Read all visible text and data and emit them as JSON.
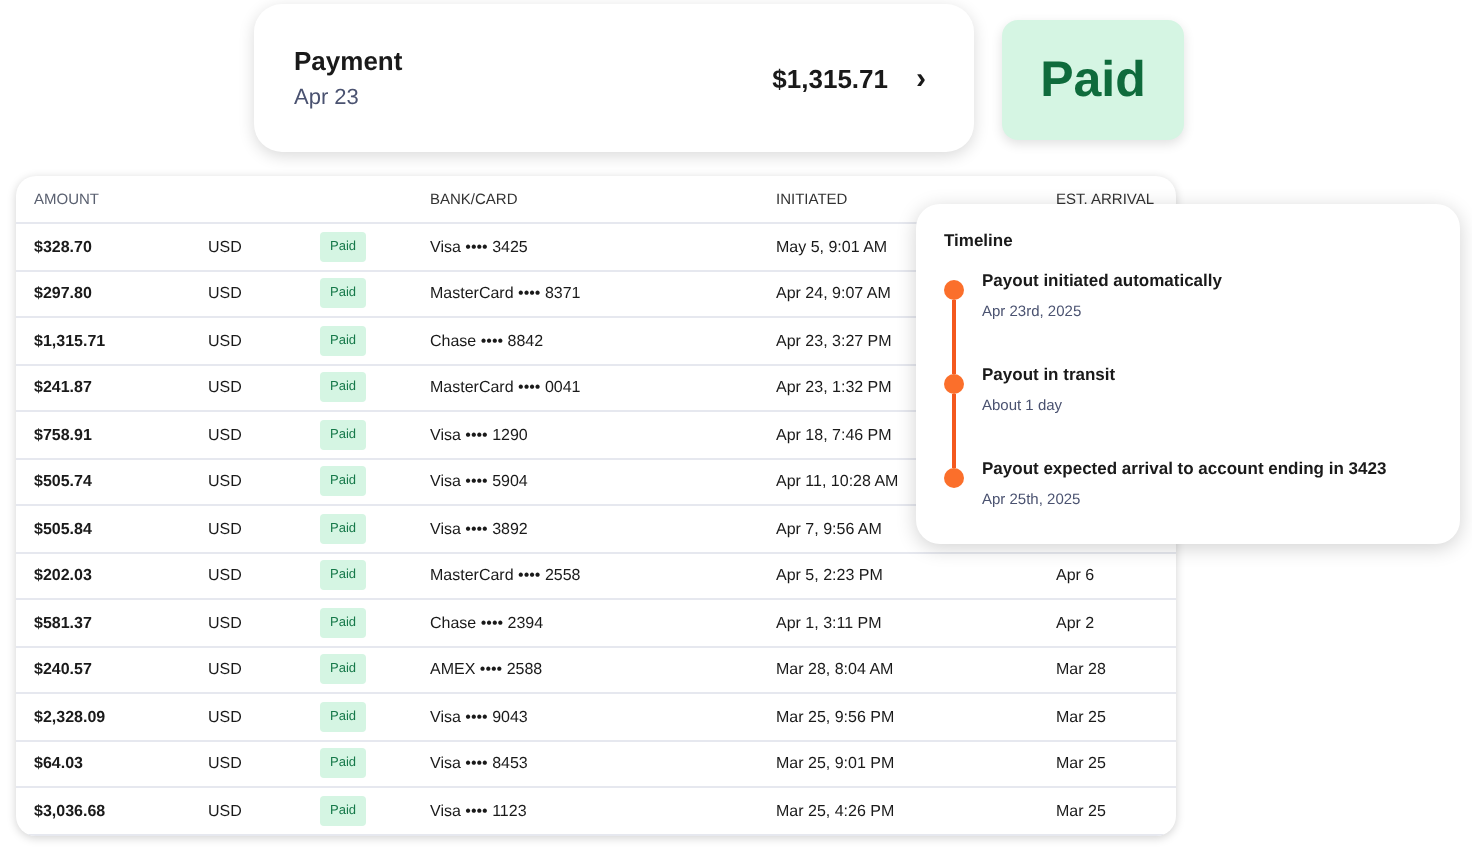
{
  "payment_card": {
    "title": "Payment",
    "date": "Apr 23",
    "amount": "$1,315.71",
    "chevron": "›"
  },
  "status_badge": "Paid",
  "table": {
    "columns": [
      "AMOUNT",
      "",
      "BANK/CARD",
      "INITIATED",
      "EST. ARRIVAL"
    ],
    "rows": [
      {
        "amount": "$328.70",
        "currency": "USD",
        "status": "Paid",
        "card": "Visa •••• 3425",
        "initiated": "May 5, 9:01 AM"
      },
      {
        "amount": "$297.80",
        "currency": "USD",
        "status": "Paid",
        "card": "MasterCard •••• 8371",
        "initiated": "Apr 24, 9:07 AM"
      },
      {
        "amount": "$1,315.71",
        "currency": "USD",
        "status": "Paid",
        "card": "Chase •••• 8842",
        "initiated": "Apr 23, 3:27 PM"
      },
      {
        "amount": "$241.87",
        "currency": "USD",
        "status": "Paid",
        "card": "MasterCard •••• 0041",
        "initiated": "Apr 23, 1:32 PM"
      },
      {
        "amount": "$758.91",
        "currency": "USD",
        "status": "Paid",
        "card": "Visa •••• 1290",
        "initiated": "Apr 18, 7:46 PM"
      },
      {
        "amount": "$505.74",
        "currency": "USD",
        "status": "Paid",
        "card": "Visa •••• 5904",
        "initiated": "Apr 11, 10:28 AM"
      },
      {
        "amount": "$505.84",
        "currency": "USD",
        "status": "Paid",
        "card": "Visa •••• 3892",
        "initiated": "Apr 7, 9:56 AM"
      },
      {
        "amount": "$202.03",
        "currency": "USD",
        "status": "Paid",
        "card": "MasterCard •••• 2558",
        "initiated": "Apr 5, 2:23 PM",
        "est_arrival": "Apr 6"
      },
      {
        "amount": "$581.37",
        "currency": "USD",
        "status": "Paid",
        "card": "Chase •••• 2394",
        "initiated": "Apr 1, 3:11 PM",
        "est_arrival": "Apr 2"
      },
      {
        "amount": "$240.57",
        "currency": "USD",
        "status": "Paid",
        "card": "AMEX •••• 2588",
        "initiated": "Mar 28, 8:04 AM",
        "est_arrival": "Mar 28"
      },
      {
        "amount": "$2,328.09",
        "currency": "USD",
        "status": "Paid",
        "card": "Visa •••• 9043",
        "initiated": "Mar 25, 9:56 PM",
        "est_arrival": "Mar 25"
      },
      {
        "amount": "$64.03",
        "currency": "USD",
        "status": "Paid",
        "card": "Visa •••• 8453",
        "initiated": "Mar 25, 9:01 PM",
        "est_arrival": "Mar 25"
      },
      {
        "amount": "$3,036.68",
        "currency": "USD",
        "status": "Paid",
        "card": "Visa •••• 1123",
        "initiated": "Mar 25, 4:26 PM",
        "est_arrival": "Mar 25"
      }
    ]
  },
  "timeline": {
    "title": "Timeline",
    "events": [
      {
        "title": "Payout initiated automatically",
        "detail": "Apr 23rd, 2025"
      },
      {
        "title": "Payout in transit",
        "detail": "About 1 day"
      },
      {
        "title": "Payout expected arrival to account ending in 3423",
        "detail": "Apr 25th, 2025"
      }
    ]
  }
}
